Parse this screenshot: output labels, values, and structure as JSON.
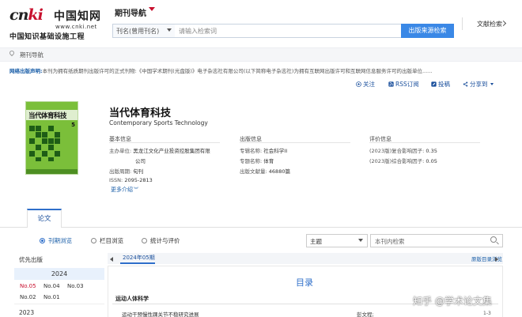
{
  "header": {
    "logo_mark_c": "c",
    "logo_mark_n": "n",
    "logo_mark_ki": "ki",
    "logo_cn": "中国知网",
    "logo_url": "www.cnki.net",
    "logo_sub": "中国知识基础设施工程",
    "nav_title": "期刊导航",
    "search_select": "刊名(曾用刊名)",
    "search_placeholder": "请输入检索词",
    "search_button": "出版来源检索",
    "right_link": "文献检索"
  },
  "breadcrumb": "期刊导航",
  "notice": {
    "label": "网络出版声明:",
    "text": "本刊为拥有纸质期刊出版许可的正式刊物:《中国学术期刊(光盘版)》电子杂志社有限公司(以下简称电子杂志社)为拥有互联网出版许可和互联网信息服务许可的出版单位......"
  },
  "actions": {
    "follow": "关注",
    "rss": "RSS订阅",
    "submit": "投稿",
    "share": "分享到"
  },
  "journal": {
    "cover_title": "当代体育科技",
    "cover_issue": "5",
    "title": "当代体育科技",
    "title_en": "Contemporary Sports Technology",
    "basic_info_title": "基本信息",
    "publish_info_title": "出版信息",
    "eval_info_title": "评价信息",
    "basic": [
      {
        "k": "主办单位:",
        "v": "黑龙江文化产业投资控股集团有限"
      },
      {
        "k": "",
        "v": "公司"
      },
      {
        "k": "出版周期:",
        "v": "旬刊"
      },
      {
        "k": "ISSN:",
        "v": "2095-2813"
      }
    ],
    "publish": [
      {
        "k": "专辑名称:",
        "v": "社会科学II"
      },
      {
        "k": "专题名称:",
        "v": "体育"
      },
      {
        "k": "出版文献量:",
        "v": "46880篇"
      }
    ],
    "eval": [
      {
        "k": "(2023版)复合影响因子:",
        "v": "0.35"
      },
      {
        "k": "(2023版)综合影响因子:",
        "v": "0.05"
      }
    ],
    "more": "更多介绍"
  },
  "tabs": {
    "lunwen": "论文"
  },
  "filters": {
    "by_issue": "刊期浏览",
    "by_column": "栏目浏览",
    "stats": "统计与评价",
    "topic_select": "主题",
    "in_search_placeholder": "本刊内检索"
  },
  "sidebar": {
    "title": "优先出版",
    "year_current": "2024",
    "issues_row1": [
      "No.05",
      "No.04",
      "No.03"
    ],
    "issues_row2": [
      "No.02",
      "No.01"
    ],
    "year_prev": "2023"
  },
  "content": {
    "issue_tab": "2024年05期",
    "toc_link": "原版目录浏览",
    "toc_heading": "目录",
    "section": "运动人体科学",
    "article_title": "运动干预慢性踝关节不稳研究进展",
    "article_author": "彭文程;",
    "article_pages": "1-3"
  },
  "watermark": "知乎 @学术论文集"
}
